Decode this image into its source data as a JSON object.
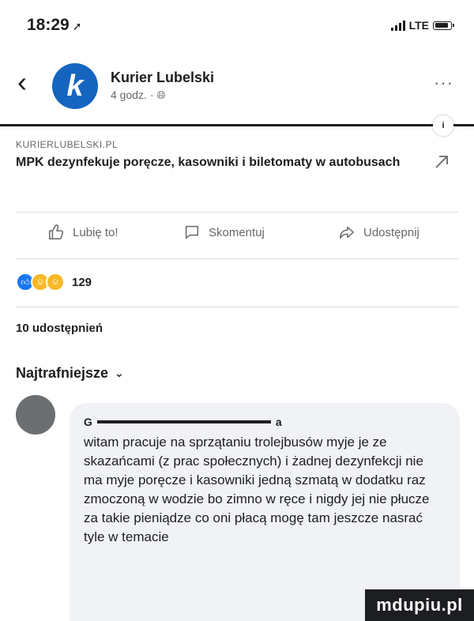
{
  "status_bar": {
    "time": "18:29",
    "network": "LTE"
  },
  "post": {
    "page_name": "Kurier Lubelski",
    "page_initial": "k",
    "meta": "4 godz. · ",
    "more_label": "···"
  },
  "link": {
    "domain": "KURIERLUBELSKI.PL",
    "title": "MPK dezynfekuje poręcze, kasowniki i biletomaty w autobusach",
    "badge": "i"
  },
  "actions": {
    "like_label": "Lubię to!",
    "comment_label": "Skomentuj",
    "share_label": "Udostępnij"
  },
  "reactions": {
    "count": "129"
  },
  "shares_text": "10 udostępnień",
  "sort_label": "Najtrafniejsze",
  "comment": {
    "author_first": "G",
    "author_last": "a",
    "text": "witam pracuje na sprzątaniu trolejbusów myje je ze skazańcami (z prac społecznych) i żadnej dezynfekcji nie ma myje poręcze i kasowniki jedną szmatą w dodatku raz zmoczoną w wodzie bo zimno w ręce i nigdy jej nie płucze za takie pieniądze co oni płacą mogę tam jeszcze nasrać tyle w temacie"
  },
  "watermark": "mdupiu.pl",
  "colors": {
    "brand": "#1565c0",
    "like": "#1877f2",
    "muted_text": "#65676b",
    "comment_bg": "#f0f2f5"
  }
}
